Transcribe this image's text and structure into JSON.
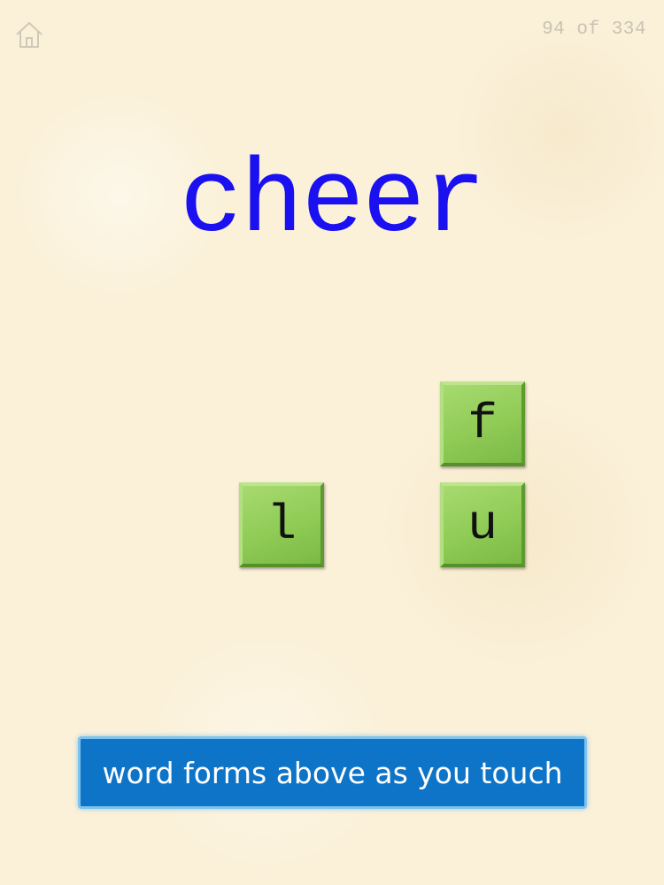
{
  "header": {
    "home_icon": "home-icon",
    "counter": "94 of 334"
  },
  "word": {
    "text": "cheer",
    "color": "#1a10f0"
  },
  "tiles": [
    {
      "letter": "f"
    },
    {
      "letter": "l"
    },
    {
      "letter": "u"
    }
  ],
  "colors": {
    "tile_green": "#8fcb55",
    "banner_blue": "#0e74c8"
  },
  "instruction": {
    "text": "word forms above as you touch"
  }
}
